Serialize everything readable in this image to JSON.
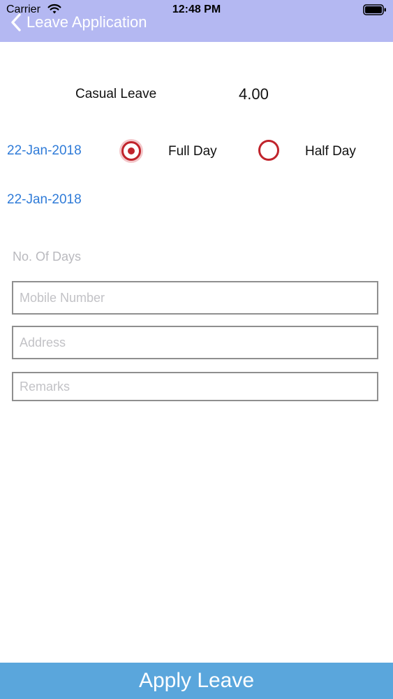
{
  "status_bar": {
    "carrier": "Carrier",
    "time": "12:48 PM",
    "wifi_icon": "wifi-icon",
    "battery_icon": "battery-icon"
  },
  "nav": {
    "back_icon": "chevron-left-icon",
    "title": "Leave Application",
    "background": "#b4b8f2"
  },
  "leave": {
    "type": "Casual Leave",
    "balance": "4.00"
  },
  "dates": {
    "from": "22-Jan-2018",
    "to": "22-Jan-2018",
    "color": "#2f7bd8"
  },
  "day_type": {
    "options": [
      {
        "label": "Full Day",
        "selected": true
      },
      {
        "label": "Half Day",
        "selected": false
      }
    ],
    "accent": "#c0232b"
  },
  "form": {
    "no_of_days_label": "No. Of Days",
    "mobile_placeholder": "Mobile Number",
    "address_placeholder": "Address",
    "remarks_placeholder": "Remarks"
  },
  "actions": {
    "apply_label": "Apply Leave",
    "apply_color": "#5aa6dc"
  }
}
